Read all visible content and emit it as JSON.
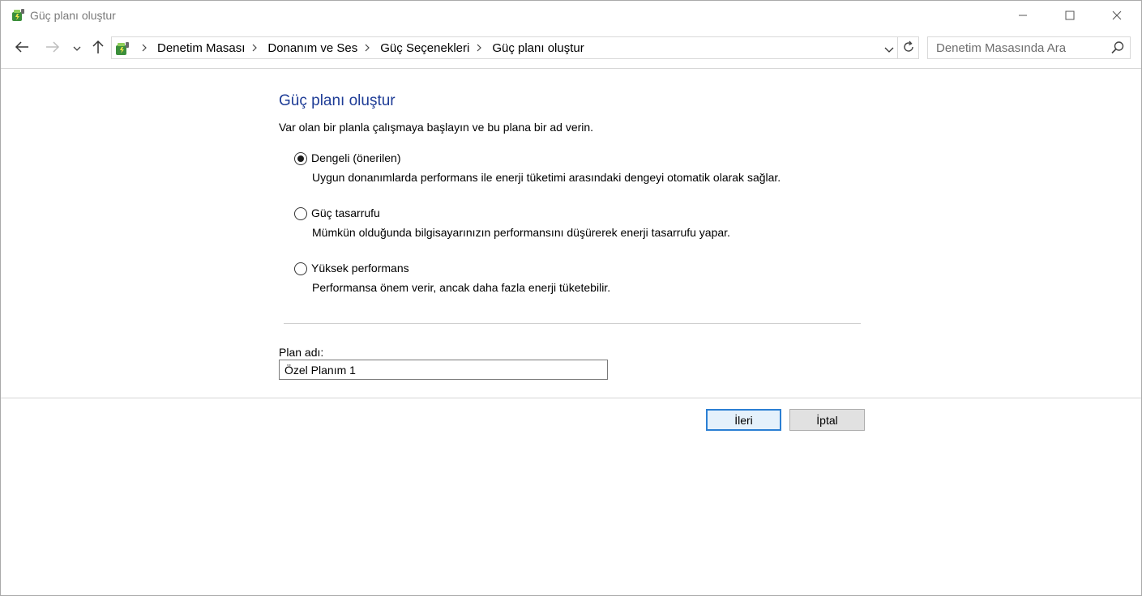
{
  "window": {
    "title": "Güç planı oluştur"
  },
  "navigation": {
    "breadcrumbs": [
      {
        "label": "Denetim Masası"
      },
      {
        "label": "Donanım ve Ses"
      },
      {
        "label": "Güç Seçenekleri"
      },
      {
        "label": "Güç planı oluştur"
      }
    ],
    "search_placeholder": "Denetim Masasında Ara"
  },
  "main": {
    "title": "Güç planı oluştur",
    "subtitle": "Var olan bir planla çalışmaya başlayın ve bu plana bir ad verin.",
    "options": [
      {
        "label": "Dengeli (önerilen)",
        "description": "Uygun donanımlarda performans ile enerji tüketimi arasındaki dengeyi otomatik olarak sağlar.",
        "selected": true
      },
      {
        "label": "Güç tasarrufu",
        "description": "Mümkün olduğunda bilgisayarınızın performansını düşürerek enerji tasarrufu yapar.",
        "selected": false
      },
      {
        "label": "Yüksek performans",
        "description": "Performansa önem verir, ancak daha fazla enerji tüketebilir.",
        "selected": false
      }
    ],
    "plan_name_label": "Plan adı:",
    "plan_name_value": "Özel Planım 1"
  },
  "buttons": {
    "next_label": "İleri",
    "cancel_label": "İptal"
  },
  "colors": {
    "title_accent": "#1e3c96",
    "default_button_border": "#2b7fd3"
  },
  "icons": {
    "app": "power-options-icon",
    "back": "arrow-left-icon",
    "forward": "arrow-right-icon",
    "recent": "chevron-down-icon",
    "up": "arrow-up-icon",
    "refresh": "refresh-icon",
    "search": "search-icon"
  }
}
